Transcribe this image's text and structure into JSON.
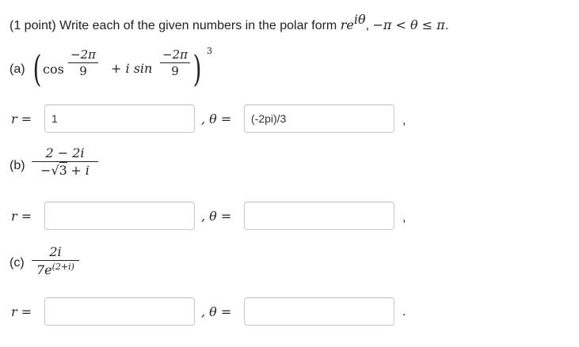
{
  "header": {
    "points": "(1 point)",
    "instruction": "Write each of the given numbers in the polar form",
    "form_base": "re",
    "form_exp": "iθ",
    "range_sep": ",",
    "range": "−π < θ ≤ π",
    "period": "."
  },
  "part_a": {
    "label": "(a)",
    "cos": "cos",
    "plus_i_sin": "+ i sin",
    "frac1_num": "−2π",
    "frac1_den": "9",
    "frac2_num": "−2π",
    "frac2_den": "9",
    "power": "3",
    "r_label": "r =",
    "theta_label": ", θ =",
    "r_value": "1",
    "theta_value": "(-2pi)/3",
    "end_punct": ","
  },
  "part_b": {
    "label": "(b)",
    "num": "2 − 2i",
    "den_sqrt": "3",
    "den_prefix": "−",
    "den_suffix": "+ i",
    "r_label": "r =",
    "theta_label": ", θ =",
    "r_value": "",
    "theta_value": "",
    "end_punct": ","
  },
  "part_c": {
    "label": "(c)",
    "num": "2i",
    "den_base": "7e",
    "den_exp": "(2+i)",
    "r_label": "r =",
    "theta_label": ", θ =",
    "r_value": "",
    "theta_value": "",
    "end_punct": "."
  }
}
